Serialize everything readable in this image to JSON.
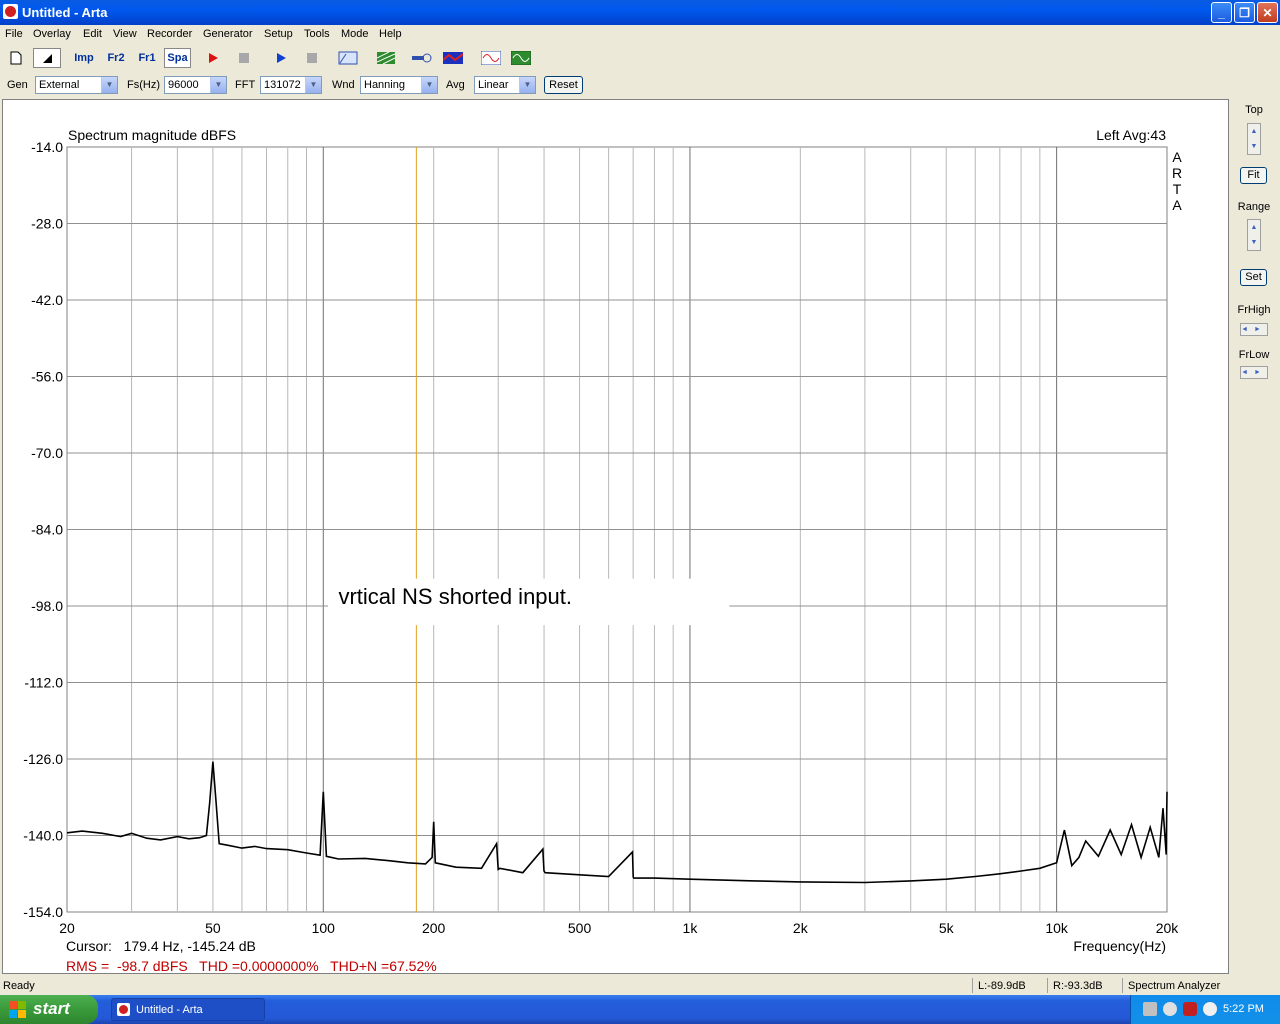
{
  "window": {
    "title": "Untitled - Arta",
    "minimize_glyph": "_",
    "restore_glyph": "❐",
    "close_glyph": "✕"
  },
  "menu": [
    "File",
    "Overlay",
    "Edit",
    "View",
    "Recorder",
    "Generator",
    "Setup",
    "Tools",
    "Mode",
    "Help"
  ],
  "toolbar": {
    "imp": "Imp",
    "fr2": "Fr2",
    "fr1": "Fr1",
    "spa": "Spa",
    "icons": [
      "new-document-icon",
      "pointer-icon",
      "impulse-mode-icon",
      "fr2-mode-icon",
      "fr1-mode-icon",
      "spectrum-mode-icon",
      "record-icon",
      "stop-icon",
      "play-icon",
      "stop-icon",
      "abc-icon",
      "grid-icon",
      "probe-icon",
      "overlay-icon",
      "generator-sine-icon",
      "scope-icon"
    ]
  },
  "settings": {
    "gen_label": "Gen",
    "gen_value": "External",
    "fs_label": "Fs(Hz)",
    "fs_value": "96000",
    "fft_label": "FFT",
    "fft_value": "131072",
    "wnd_label": "Wnd",
    "wnd_value": "Hanning",
    "avg_label": "Avg",
    "avg_value": "Linear",
    "reset_label": "Reset"
  },
  "side_panel": {
    "top_label": "Top",
    "fit_label": "Fit",
    "range_label": "Range",
    "set_label": "Set",
    "frhigh_label": "FrHigh",
    "frlow_label": "FrLow"
  },
  "chart_data": {
    "type": "line",
    "title": "Spectrum magnitude dBFS",
    "channel_info": "Left  Avg:43",
    "watermark": "ARTA",
    "xlabel": "Frequency(Hz)",
    "x_scale": "log",
    "xlim": [
      20,
      20000
    ],
    "ylim": [
      -154,
      -14
    ],
    "y_ticks": [
      "-14.0",
      "-28.0",
      "-42.0",
      "-56.0",
      "-70.0",
      "-84.0",
      "-98.0",
      "-112.0",
      "-126.0",
      "-140.0",
      "-154.0"
    ],
    "y_tick_values": [
      -14,
      -28,
      -42,
      -56,
      -70,
      -84,
      -98,
      -112,
      -126,
      -140,
      -154
    ],
    "x_ticks": [
      "20",
      "50",
      "100",
      "200",
      "500",
      "1k",
      "2k",
      "5k",
      "10k",
      "20k"
    ],
    "x_tick_values": [
      20,
      50,
      100,
      200,
      500,
      1000,
      2000,
      5000,
      10000,
      20000
    ],
    "grid": true,
    "cursor_freq": 179.4,
    "cursor_text": "Cursor:   179.4 Hz, -145.24 dB",
    "annotation": "vrtical NS shorted input.",
    "measurements": "RMS =  -98.7 dBFS   THD =0.0000000%   THD+N =67.52%",
    "series": [
      {
        "x": [
          20,
          22,
          25,
          28,
          30,
          33,
          36,
          40,
          43,
          46,
          48,
          49,
          50,
          51,
          52,
          55,
          60,
          65,
          70,
          80,
          90,
          98,
          100,
          102,
          110,
          130,
          150,
          170,
          190,
          198,
          200,
          202,
          230,
          270,
          297,
          300,
          303,
          350,
          397,
          400,
          403,
          500,
          600,
          697,
          700,
          703,
          800,
          1000,
          1500,
          2000,
          3000,
          4000,
          5000,
          6000,
          7000,
          8000,
          9000,
          10000,
          10500,
          11000,
          11500,
          12000,
          13000,
          14000,
          15000,
          16000,
          17000,
          18000,
          19000,
          19500,
          19900,
          20000
        ],
        "y": [
          -139.5,
          -139.2,
          -139.6,
          -140.2,
          -139.6,
          -140.5,
          -140.8,
          -140.2,
          -140.6,
          -140.4,
          -140.0,
          -134.0,
          -126.5,
          -134.0,
          -141.5,
          -141.8,
          -142.3,
          -142.0,
          -142.4,
          -142.6,
          -143.2,
          -143.6,
          -132.0,
          -143.8,
          -144.3,
          -144.2,
          -144.6,
          -145.0,
          -145.2,
          -144.0,
          -137.5,
          -145.0,
          -145.8,
          -146.0,
          -141.5,
          -146.2,
          -146.0,
          -146.8,
          -142.5,
          -146.5,
          -146.8,
          -147.2,
          -147.5,
          -143.0,
          -147.6,
          -147.8,
          -147.8,
          -148.0,
          -148.3,
          -148.5,
          -148.6,
          -148.3,
          -148.0,
          -147.5,
          -147.0,
          -146.5,
          -146.0,
          -145.0,
          -139.0,
          -145.5,
          -144.0,
          -141.0,
          -143.8,
          -139.0,
          -143.5,
          -138.0,
          -144.0,
          -138.5,
          -144.0,
          -135.0,
          -143.5,
          -132.0
        ]
      }
    ]
  },
  "status": {
    "ready": "Ready",
    "left_level": "L:-89.9dB",
    "right_level": "R:-93.3dB",
    "mode": "Spectrum Analyzer"
  },
  "taskbar": {
    "start": "start",
    "task": "Untitled - Arta",
    "clock": "5:22 PM"
  }
}
